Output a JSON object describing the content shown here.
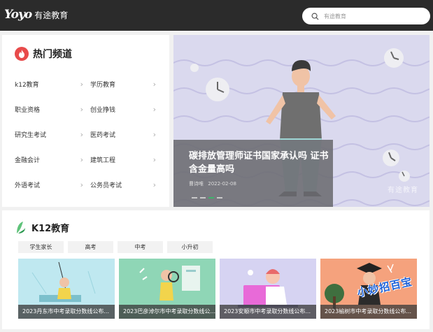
{
  "header": {
    "logo_mark": "Yoyo",
    "logo_text": "有途教育",
    "search_placeholder": "有途教育"
  },
  "channels": {
    "title": "热门频道",
    "items": [
      {
        "label": "k12教育"
      },
      {
        "label": "学历教育"
      },
      {
        "label": "职业资格"
      },
      {
        "label": "创业挣钱"
      },
      {
        "label": "研究生考试"
      },
      {
        "label": "医药考试"
      },
      {
        "label": "金融会计"
      },
      {
        "label": "建筑工程"
      },
      {
        "label": "外语考试"
      },
      {
        "label": "公务员考试"
      }
    ],
    "chevron": "›"
  },
  "banner": {
    "title": "碳排放管理师证书国家承认吗 证书含金量高吗",
    "author": "曹诗唯",
    "date": "2022-02-08",
    "watermark": "有途教育",
    "slide_count": 4,
    "active_slide": 2
  },
  "k12": {
    "title": "K12教育",
    "tabs": [
      {
        "label": "学生家长"
      },
      {
        "label": "高考"
      },
      {
        "label": "中考"
      },
      {
        "label": "小升初"
      }
    ],
    "cards": [
      {
        "label": "2023丹东市中考录取分数线公布...",
        "bg": "#bfe8f0"
      },
      {
        "label": "2023巴彦淖尔市中考录取分数线公...",
        "bg": "#8fd6b6"
      },
      {
        "label": "2023安顺市中考录取分数线公布...",
        "bg": "#d6d3f2"
      },
      {
        "label": "2023榆树市中考录取分数线公布...",
        "bg": "#f5a27d"
      }
    ],
    "stamp": "小妙招百宝"
  }
}
